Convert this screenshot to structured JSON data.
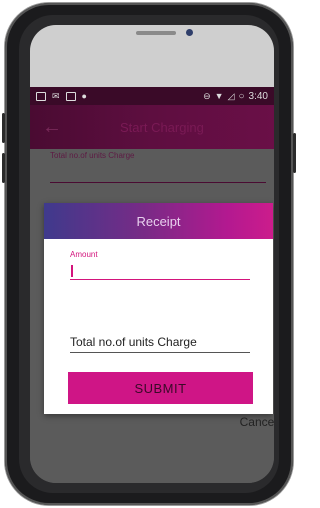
{
  "status_bar": {
    "time": "3:40"
  },
  "app_bar": {
    "title": "Start Charging"
  },
  "background_form": {
    "units_label": "Total no.of units Charge"
  },
  "dialog": {
    "title": "Receipt",
    "amount_label": "Amount",
    "amount_value": "",
    "units_field_text": "Total no.of units Charge",
    "submit_label": "SUBMIT",
    "cancel_label": "Cancel"
  },
  "colors": {
    "primary": "#cf1586",
    "app_bar": "#5e0e40",
    "header_gradient_start": "#3f3a8c",
    "header_gradient_end": "#cc1c8c"
  }
}
